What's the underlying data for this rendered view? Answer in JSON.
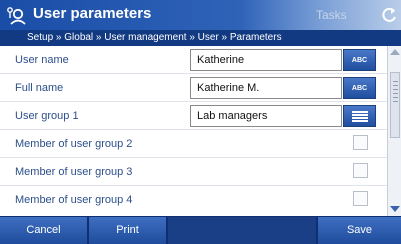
{
  "window": {
    "title": "User parameters",
    "tasks_label": "Tasks",
    "app_icon": "user-settings-icon",
    "refresh_icon": "refresh-icon"
  },
  "breadcrumb": "Setup » Global » User management » User » Parameters",
  "fields": {
    "user_name": {
      "label": "User name",
      "value": "Katherine",
      "button": "ABC"
    },
    "full_name": {
      "label": "Full name",
      "value": "Katherine M.",
      "button": "ABC"
    },
    "user_group_1": {
      "label": "User group 1",
      "value": "Lab managers",
      "button_icon": "list-icon"
    }
  },
  "checkboxes": [
    {
      "label": "Member of user group 2",
      "checked": false
    },
    {
      "label": "Member of user group 3",
      "checked": false
    },
    {
      "label": "Member of user group 4",
      "checked": false
    }
  ],
  "footer": {
    "cancel": "Cancel",
    "print": "Print",
    "save": "Save"
  },
  "colors": {
    "accent": "#1f4c9c",
    "label_text": "#2d4f8a"
  }
}
